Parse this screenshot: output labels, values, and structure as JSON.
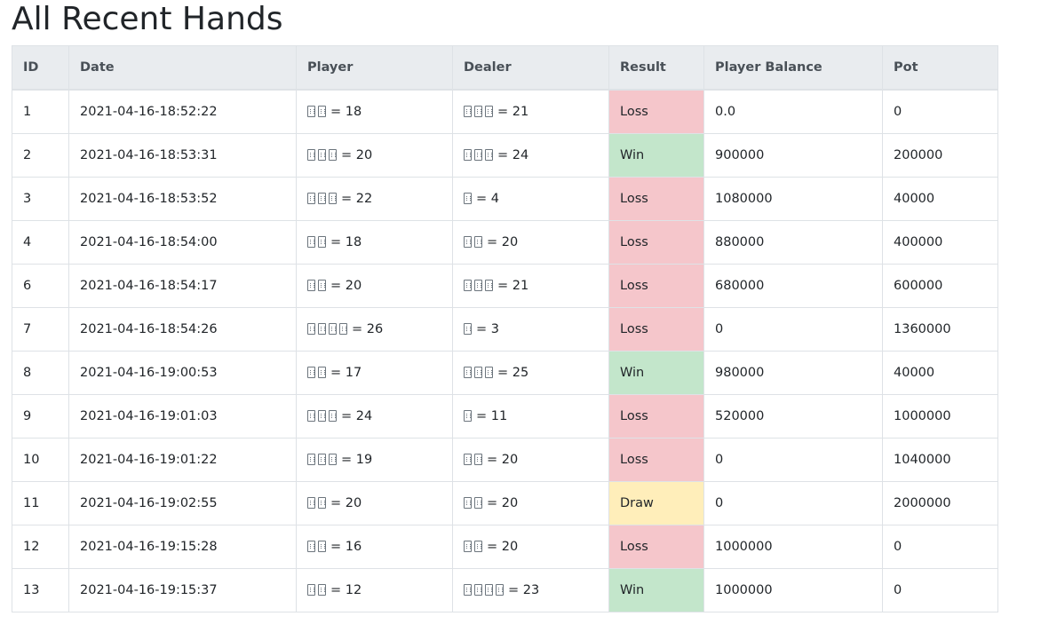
{
  "page_title": "All Recent Hands",
  "table": {
    "headers": {
      "id": "ID",
      "date": "Date",
      "player": "Player",
      "dealer": "Dealer",
      "result": "Result",
      "balance": "Player Balance",
      "pot": "Pot"
    },
    "rows": [
      {
        "id": "1",
        "date": "2021-04-16-18:52:22",
        "player_cards": 2,
        "player_total": "= 18",
        "dealer_cards": 3,
        "dealer_total": "= 21",
        "result": "Loss",
        "balance": "0.0",
        "pot": "0"
      },
      {
        "id": "2",
        "date": "2021-04-16-18:53:31",
        "player_cards": 3,
        "player_total": "= 20",
        "dealer_cards": 3,
        "dealer_total": "= 24",
        "result": "Win",
        "balance": "900000",
        "pot": "200000"
      },
      {
        "id": "3",
        "date": "2021-04-16-18:53:52",
        "player_cards": 3,
        "player_total": "= 22",
        "dealer_cards": 1,
        "dealer_total": "= 4",
        "result": "Loss",
        "balance": "1080000",
        "pot": "40000"
      },
      {
        "id": "4",
        "date": "2021-04-16-18:54:00",
        "player_cards": 2,
        "player_total": "= 18",
        "dealer_cards": 2,
        "dealer_total": "= 20",
        "result": "Loss",
        "balance": "880000",
        "pot": "400000"
      },
      {
        "id": "6",
        "date": "2021-04-16-18:54:17",
        "player_cards": 2,
        "player_total": "= 20",
        "dealer_cards": 3,
        "dealer_total": "= 21",
        "result": "Loss",
        "balance": "680000",
        "pot": "600000"
      },
      {
        "id": "7",
        "date": "2021-04-16-18:54:26",
        "player_cards": 4,
        "player_total": "= 26",
        "dealer_cards": 1,
        "dealer_total": "= 3",
        "result": "Loss",
        "balance": "0",
        "pot": "1360000"
      },
      {
        "id": "8",
        "date": "2021-04-16-19:00:53",
        "player_cards": 2,
        "player_total": "= 17",
        "dealer_cards": 3,
        "dealer_total": "= 25",
        "result": "Win",
        "balance": "980000",
        "pot": "40000"
      },
      {
        "id": "9",
        "date": "2021-04-16-19:01:03",
        "player_cards": 3,
        "player_total": "= 24",
        "dealer_cards": 1,
        "dealer_total": "= 11",
        "result": "Loss",
        "balance": "520000",
        "pot": "1000000"
      },
      {
        "id": "10",
        "date": "2021-04-16-19:01:22",
        "player_cards": 3,
        "player_total": "= 19",
        "dealer_cards": 2,
        "dealer_total": "= 20",
        "result": "Loss",
        "balance": "0",
        "pot": "1040000"
      },
      {
        "id": "11",
        "date": "2021-04-16-19:02:55",
        "player_cards": 2,
        "player_total": "= 20",
        "dealer_cards": 2,
        "dealer_total": "= 20",
        "result": "Draw",
        "balance": "0",
        "pot": "2000000"
      },
      {
        "id": "12",
        "date": "2021-04-16-19:15:28",
        "player_cards": 2,
        "player_total": "= 16",
        "dealer_cards": 2,
        "dealer_total": "= 20",
        "result": "Loss",
        "balance": "1000000",
        "pot": "0"
      },
      {
        "id": "13",
        "date": "2021-04-16-19:15:37",
        "player_cards": 2,
        "player_total": "= 12",
        "dealer_cards": 4,
        "dealer_total": "= 23",
        "result": "Win",
        "balance": "1000000",
        "pot": "0"
      }
    ]
  },
  "colors": {
    "header_bg": "#e9ecef",
    "loss_bg": "#f5c6cb",
    "win_bg": "#c3e6cb",
    "draw_bg": "#ffeeba",
    "border": "#dee2e6"
  },
  "icons": {
    "card": "playing-card-icon"
  }
}
